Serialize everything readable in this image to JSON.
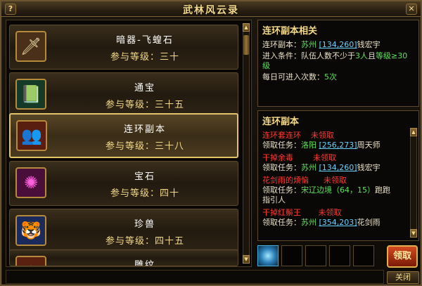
{
  "window": {
    "title": "武林风云录",
    "help": "?",
    "close": "✕"
  },
  "list": {
    "items": [
      {
        "name": "暗器-飞蝗石",
        "level": "参与等级：三十",
        "icon": "dart-icon",
        "icon_glyph": "🗡",
        "icon_bg": "#4a3018"
      },
      {
        "name": "通宝",
        "level": "参与等级：三十五",
        "icon": "treasure-book-icon",
        "icon_glyph": "📗",
        "icon_bg": "#163a28"
      },
      {
        "name": "连环副本",
        "level": "参与等级：三十八",
        "icon": "warriors-icon",
        "icon_glyph": "👥",
        "icon_bg": "#5a1e10"
      },
      {
        "name": "宝石",
        "level": "参与等级：四十",
        "icon": "gem-icon",
        "icon_glyph": "✺",
        "icon_bg": "#4a0e3a"
      },
      {
        "name": "珍兽",
        "level": "参与等级：四十五",
        "icon": "beast-icon",
        "icon_glyph": "🐯",
        "icon_bg": "#1a2a5a"
      },
      {
        "name": "雕纹",
        "level": "",
        "icon": "engraving-icon",
        "icon_glyph": "✦",
        "icon_bg": "#5a2010"
      }
    ],
    "selected_index": 2
  },
  "info": {
    "title": "连环副本相关",
    "line1_label": "连环副本：",
    "line1_city": "苏州",
    "line1_coords": "[134,260]",
    "line1_npc": "钱宏宇",
    "line2_label": "进入条件：",
    "line2_a": "队伍人数不少于",
    "line2_b": "3人",
    "line2_c": "且",
    "line2_d": "等级≥30",
    "line2_e": "级",
    "line3_label": "每日可进入次数：",
    "line3_value": "5次"
  },
  "quests": {
    "title": "连环副本",
    "entries": [
      {
        "name": "连环套连环",
        "status": "未领取",
        "label": "领取任务：",
        "city": "洛阳",
        "coords": "[256,273]",
        "npc": "周天师"
      },
      {
        "name": "干掉余毒",
        "status": "未领取",
        "label": "领取任务：",
        "city": "苏州",
        "coords": "[134,260]",
        "npc": "钱宏宇"
      },
      {
        "name": "花剑雨的烦恼",
        "status": "未领取",
        "label": "领取任务：",
        "city": "宋辽边境",
        "coords": "（64，15）",
        "npc": "跑跑",
        "npc2": "指引人"
      },
      {
        "name": "干掉红鬃王",
        "status": "未领取",
        "label": "领取任务：",
        "city": "苏州",
        "coords": "[354,203]",
        "npc": "花剑雨"
      }
    ]
  },
  "reward_slots": [
    {
      "icon": "reward-orb-icon",
      "filled": true
    },
    {
      "filled": false
    },
    {
      "filled": false
    },
    {
      "filled": false
    },
    {
      "filled": false
    },
    {
      "filled": false
    }
  ],
  "buttons": {
    "claim": "领取",
    "close": "关闭"
  },
  "colors": {
    "accent": "#f3d98a",
    "selected_border": "#e3c36a",
    "green": "#5fe05a",
    "link": "#6ad2ff",
    "red": "#ff3b30"
  }
}
